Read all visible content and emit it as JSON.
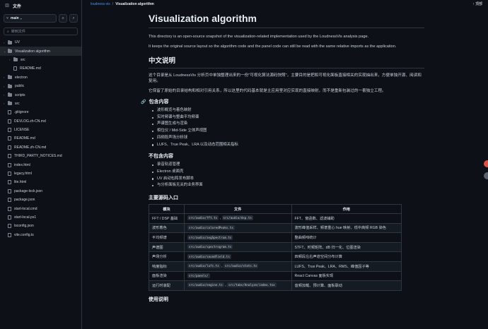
{
  "sidebar": {
    "title": "文件",
    "branch": "main",
    "search_placeholder": "转到文件",
    "tree": [
      {
        "type": "folder",
        "name": "UV",
        "indent": 0,
        "arrow": "›",
        "selected": false
      },
      {
        "type": "folder",
        "name": "Visualization algorithm",
        "indent": 0,
        "arrow": "⌄",
        "selected": true
      },
      {
        "type": "folder",
        "name": "src",
        "indent": 1,
        "arrow": "›",
        "selected": false
      },
      {
        "type": "file",
        "name": "README.md",
        "indent": 1,
        "arrow": "",
        "selected": false
      },
      {
        "type": "folder",
        "name": "electron",
        "indent": 0,
        "arrow": "›",
        "selected": false
      },
      {
        "type": "folder",
        "name": "public",
        "indent": 0,
        "arrow": "›",
        "selected": false
      },
      {
        "type": "folder",
        "name": "scripts",
        "indent": 0,
        "arrow": "›",
        "selected": false
      },
      {
        "type": "folder",
        "name": "src",
        "indent": 0,
        "arrow": "›",
        "selected": false
      },
      {
        "type": "file",
        "name": ".gitignore",
        "indent": 0,
        "arrow": "",
        "selected": false
      },
      {
        "type": "file",
        "name": "DEVLOG.zh-CN.md",
        "indent": 0,
        "arrow": "",
        "selected": false
      },
      {
        "type": "file",
        "name": "LICENSE",
        "indent": 0,
        "arrow": "",
        "selected": false
      },
      {
        "type": "file",
        "name": "README.md",
        "indent": 0,
        "arrow": "",
        "selected": false
      },
      {
        "type": "file",
        "name": "README.zh-CN.md",
        "indent": 0,
        "arrow": "",
        "selected": false
      },
      {
        "type": "file",
        "name": "THIRD_PARTY_NOTICES.md",
        "indent": 0,
        "arrow": "",
        "selected": false
      },
      {
        "type": "file",
        "name": "index.html",
        "indent": 0,
        "arrow": "",
        "selected": false
      },
      {
        "type": "file",
        "name": "legacy.html",
        "indent": 0,
        "arrow": "",
        "selected": false
      },
      {
        "type": "file",
        "name": "lite.html",
        "indent": 0,
        "arrow": "",
        "selected": false
      },
      {
        "type": "file",
        "name": "package-lock.json",
        "indent": 0,
        "arrow": "",
        "selected": false
      },
      {
        "type": "file",
        "name": "package.json",
        "indent": 0,
        "arrow": "",
        "selected": false
      },
      {
        "type": "file",
        "name": "start-local.cmd",
        "indent": 0,
        "arrow": "",
        "selected": false
      },
      {
        "type": "file",
        "name": "start-local.ps1",
        "indent": 0,
        "arrow": "",
        "selected": false
      },
      {
        "type": "file",
        "name": "tsconfig.json",
        "indent": 0,
        "arrow": "",
        "selected": false
      },
      {
        "type": "file",
        "name": "vite.config.ts",
        "indent": 0,
        "arrow": "",
        "selected": false
      }
    ]
  },
  "breadcrumb": {
    "repo": "loudness-vis",
    "separator": "/",
    "current": "Visualization algorithm",
    "top_label": "↑ 顶部"
  },
  "doc": {
    "title": "Visualization algorithm",
    "intro_1": "This directory is an open-source snapshot of the visualization-related implementation used by the LoudnessVis analysis page.",
    "intro_2": "It keeps the original source layout so the algorithm code and the panel code can still be read with the same relative imports as the application.",
    "zh_heading": "中文说明",
    "zh_p1": "这个目录是从 LoudnessVis 分析页中单独整理出来的一份\"可视化算法源码快照\"，主要目的是把和可视化面板直接相关的实现抽出来，方便单独开源、阅读和复用。",
    "zh_p2": "它保留了原始的目录结构和相对引用关系，所以这里的代码基本就是主应用里对应实现的直接映射，而不是重新包装过的一套独立工程。",
    "includes_heading": "包含内容",
    "includes": [
      "波形概览与着色映射",
      "实时频谱与整曲平均频谱",
      "声谱图生成与渲染",
      "相位仪 / Mid-Side 立体声视图",
      "四频段声场分析球",
      "LUFS、True Peak、LRA 以及动态范围相关指标"
    ],
    "excludes_heading": "不包含内容",
    "excludes": [
      "录音轨道管理",
      "Electron 桌面壳",
      "UV 启动包和发布脚本",
      "与分析面板无关的业务界面"
    ],
    "table_heading": "主要源码入口",
    "table_headers": [
      "模块",
      "文件",
      "作用"
    ],
    "table_rows": [
      {
        "module": "FFT / DSP 基础",
        "files": [
          "src/audio/fft.ts",
          "src/audio/dsp.ts"
        ],
        "role": "FFT、窗函数、滤波辅助"
      },
      {
        "module": "波形着色",
        "files": [
          "src/audio/coloredPeaks.ts"
        ],
        "role": "波形峰值采样、频谱重心 hue 映射、低中高频 RGB 染色"
      },
      {
        "module": "平均频谱",
        "files": [
          "src/audio/avgSpectrum.ts"
        ],
        "role": "整曲频响统计"
      },
      {
        "module": "声谱图",
        "files": [
          "src/audio/spectrogram.ts"
        ],
        "role": "STFT、时频矩阵、dB 归一化、位图渲染"
      },
      {
        "module": "声场分析",
        "files": [
          "src/audio/soundField.ts"
        ],
        "role": "四频段左右声道空间分布计算"
      },
      {
        "module": "响度指标",
        "files": [
          "src/audio/lufs.ts",
          "src/audio/stats.ts"
        ],
        "role": "LUFS、True Peak、LRA、RMS、峰值因子等"
      },
      {
        "module": "面板渲染",
        "files": [
          "src/panels/"
        ],
        "role": "React Canvas 面板实现"
      },
      {
        "module": "运行时装配",
        "files": [
          "src/audio/engine.ts",
          "src/tabs/Analyze/index.tsx"
        ],
        "role": "音频加载、预计算、面板联动"
      }
    ],
    "usage_heading": "使用说明"
  }
}
